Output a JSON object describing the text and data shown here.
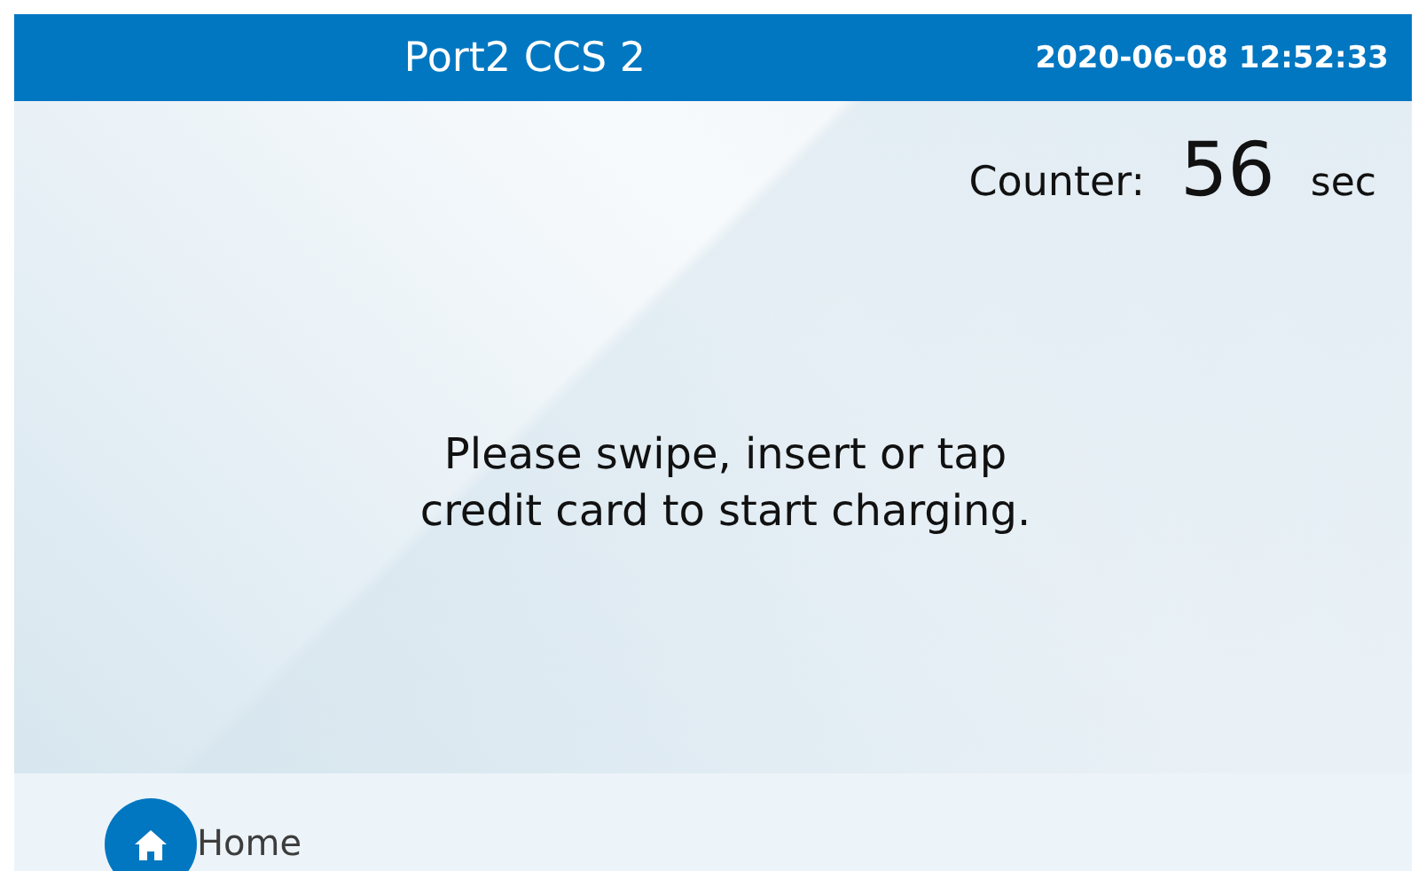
{
  "header": {
    "title": "Port2 CCS 2",
    "datetime": "2020-06-08 12:52:33"
  },
  "counter": {
    "label": "Counter:",
    "value": "56",
    "unit": "sec"
  },
  "message": "Please swipe, insert or tap\ncredit card to start charging.",
  "footer": {
    "home_label": "Home"
  }
}
